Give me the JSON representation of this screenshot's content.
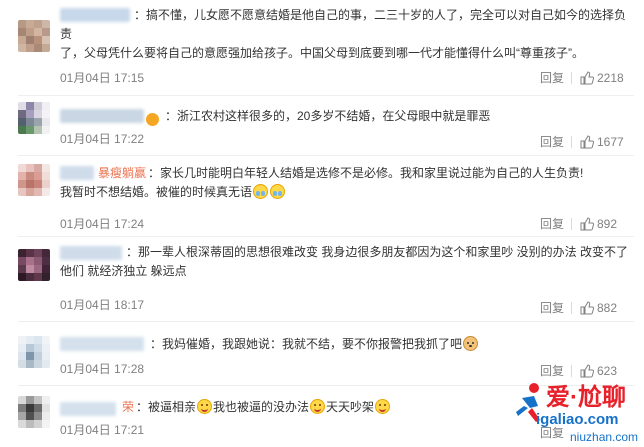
{
  "comments": [
    {
      "body_l1": "：搞不懂，儿女愿不愿意结婚是他自己的事，二三十岁的人了，完全可以对自己如今的选择负责",
      "body_l2": "了，父母凭什么要将自己的意愿强加给孩子。中国父母到底要到哪一代才能懂得什么叫“尊重孩子”。",
      "time": "01月04日 17:15",
      "reply": "回复",
      "likes": "2218"
    },
    {
      "body_l1": "：浙江农村这样很多的，20多岁不结婚，在父母眼中就是罪恶",
      "time": "01月04日 17:22",
      "reply": "回复",
      "likes": "1677"
    },
    {
      "username": "暴瘦躺赢",
      "body_l1": "：家长几时能明白年轻人结婚是选修不是必修。我和家里说过能为自己的人生负责!",
      "body_l2": "我暂时不想结婚。被催的时候真无语",
      "time": "01月04日 17:24",
      "reply": "回复",
      "likes": "892"
    },
    {
      "body_l1": "：那一辈人根深蒂固的思想很难改变 我身边很多朋友都因为这个和家里吵 没别的办法 改变不了",
      "body_l2": "他们 就经济独立 躲远点",
      "time": "01月04日 18:17",
      "reply": "回复",
      "likes": "882"
    },
    {
      "body_l1": "：我妈催婚，我跟她说：我就不结，要不你报警把我抓了吧",
      "time": "01月04日 17:28",
      "reply": "回复",
      "likes": "623"
    },
    {
      "username": "荣",
      "body_l1": "：被逼相亲",
      "body_mid": "我也被逼的没办法",
      "body_end": "天天吵架",
      "time": "01月04日 17:21",
      "reply": "回复"
    }
  ],
  "icons": {
    "verified": "verified-badge-icon",
    "like": "thumbs-up-icon",
    "emoji_cry": "crying-face-emoji-icon",
    "emoji_smile": "smiling-face-emoji-icon",
    "emoji_doge": "doge-emoji-icon"
  },
  "watermark": {
    "title": "爱·尬聊",
    "url": "igaliao.com",
    "site": "niuzhan.com"
  },
  "colors": {
    "username": "#eb7350",
    "text": "#333333",
    "meta": "#808080",
    "watermark_red": "#e8202a",
    "watermark_blue": "#1672c9"
  }
}
